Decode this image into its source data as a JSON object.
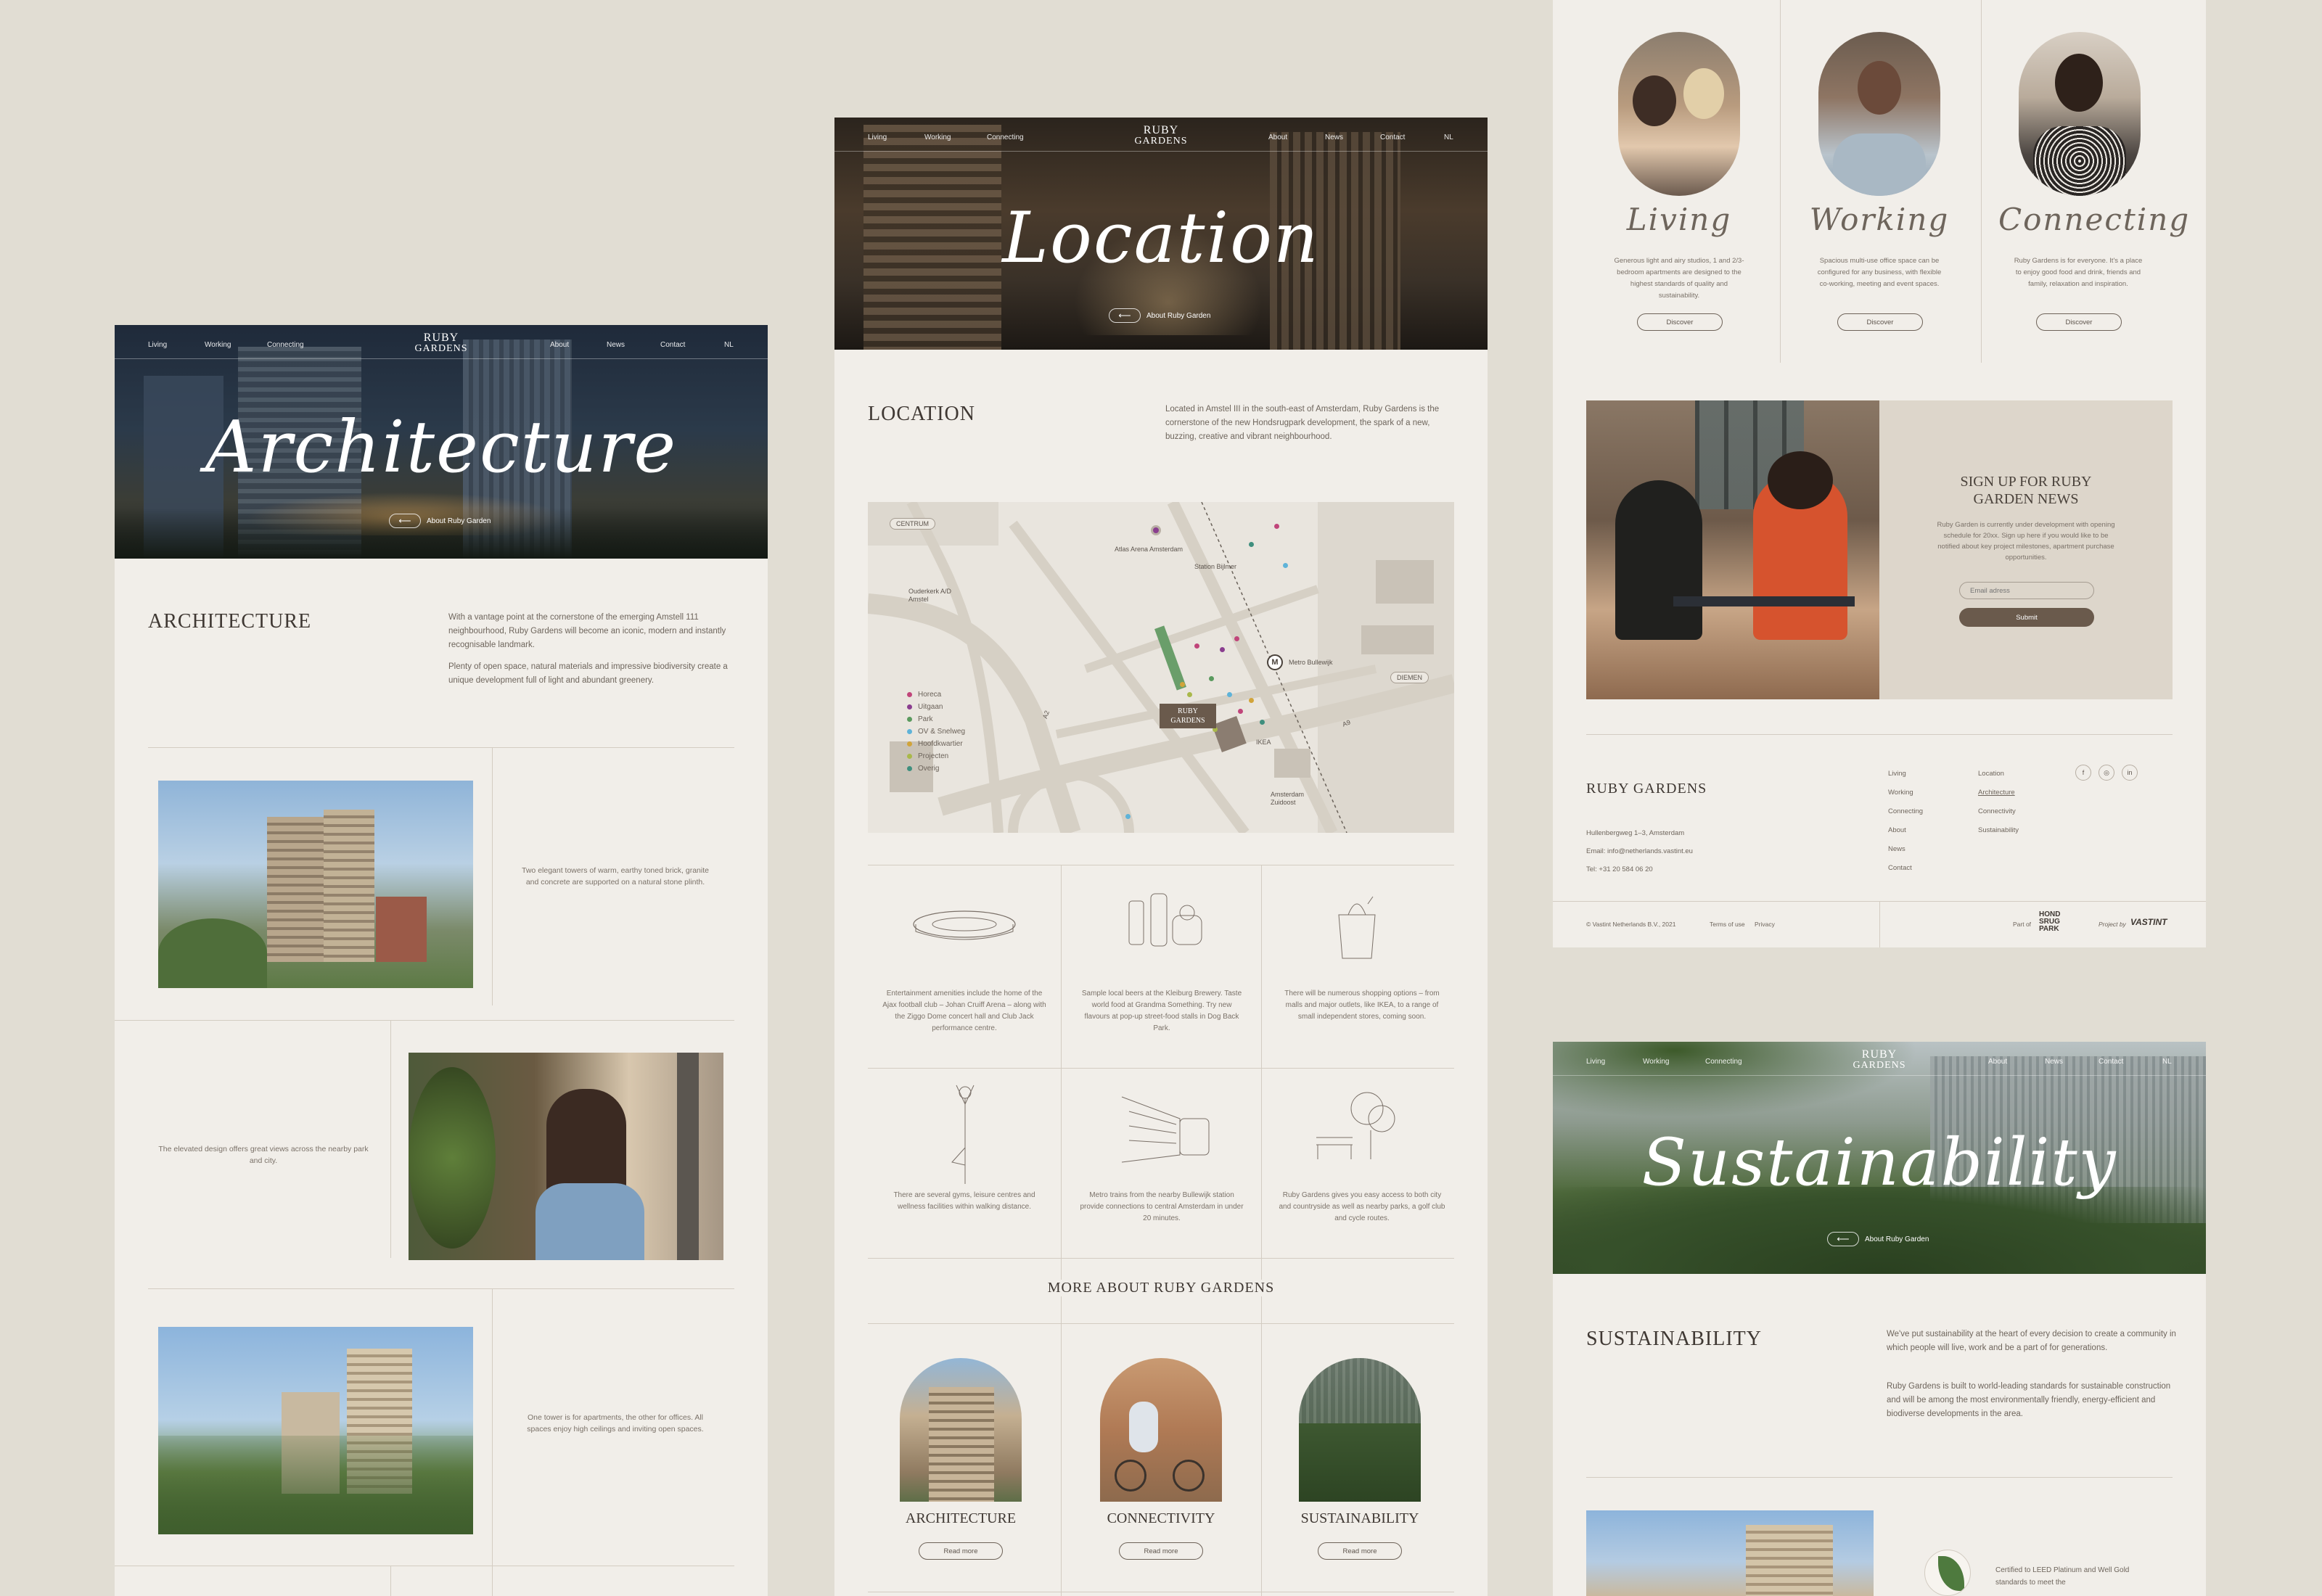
{
  "arch": {
    "nav": {
      "items": [
        "Living",
        "Working",
        "Connecting",
        "About",
        "News",
        "Contact",
        "NL"
      ],
      "logo_top": "RUBY",
      "logo_bottom": "GARDENS"
    },
    "hero_title": "Architecture",
    "back_label": "About Ruby Garden",
    "heading": "ARCHITECTURE",
    "intro1": "With a vantage point at the cornerstone of the emerging Amstell 111 neighbourhood, Ruby Gardens will become an iconic, modern and instantly recognisable landmark.",
    "intro2": "Plenty of open space, natural materials and impressive biodiversity create a unique development full of light and abundant greenery.",
    "caption1": "Two elegant towers of warm, earthy toned brick, granite and concrete are supported on a natural stone plinth.",
    "caption2": "The elevated design offers great views across the nearby park and city.",
    "caption3": "One tower is for apartments, the other for offices. All spaces enjoy high ceilings and inviting open spaces."
  },
  "loc": {
    "nav": {
      "items": [
        "Living",
        "Working",
        "Connecting",
        "About",
        "News",
        "Contact",
        "NL"
      ],
      "logo_top": "RUBY",
      "logo_bottom": "GARDENS"
    },
    "hero_title": "Location",
    "back_label": "About Ruby Garden",
    "heading": "LOCATION",
    "intro": "Located in Amstel III in the south-east of Amsterdam, Ruby Gardens is the cornerstone of the new Hondsrugpark development, the spark of a new, buzzing, creative and vibrant neighbourhood.",
    "map": {
      "centrum": "CENTRUM",
      "diemen": "DIEMEN",
      "ouderkerk": "Ouderkerk A/D Amstel",
      "arena": "Atlas Arena Amsterdam",
      "station": "Station Bijlmer",
      "metro": "Metro Bullewijk",
      "ikea": "IKEA",
      "zuidoost": "Amsterdam Zuidoost",
      "ruby_top": "RUBY",
      "ruby_bottom": "GARDENS",
      "a2": "A2",
      "a9": "A9",
      "metro_letter": "M",
      "legend": [
        {
          "label": "Horeca",
          "color": "#c0457a"
        },
        {
          "label": "Uitgaan",
          "color": "#8a3e8f"
        },
        {
          "label": "Park",
          "color": "#5a9a5e"
        },
        {
          "label": "OV & Snelweg",
          "color": "#5fb3d8"
        },
        {
          "label": "Hoofdkwartier",
          "color": "#d1a43a"
        },
        {
          "label": "Projecten",
          "color": "#a9b84a"
        },
        {
          "label": "Overig",
          "color": "#3f8f7e"
        }
      ]
    },
    "cells": [
      "Entertainment amenities include the home of the Ajax football club – Johan Cruiff Arena – along with the Ziggo Dome concert hall and Club Jack performance centre.",
      "Sample local beers at the Kleiburg Brewery. Taste world food at Grandma Something. Try new flavours at pop-up street-food stalls in Dog Back Park.",
      "There will be numerous shopping options – from malls and major outlets, like IKEA, to a range of small independent stores, coming soon.",
      "There are several gyms, leisure centres and wellness facilities within walking distance.",
      "Metro trains from the nearby Bullewijk station provide connections to central Amsterdam in under 20 minutes.",
      "Ruby Gardens gives you easy access to both city and countryside as well as nearby parks, a golf club and cycle routes."
    ],
    "more_heading": "MORE ABOUT RUBY GARDENS",
    "more": [
      {
        "title": "ARCHITECTURE",
        "button": "Read more"
      },
      {
        "title": "CONNECTIVITY",
        "button": "Read more"
      },
      {
        "title": "SUSTAINABILITY",
        "button": "Read more"
      }
    ]
  },
  "home": {
    "cards": [
      {
        "title": "Living",
        "text": "Generous light and airy studios, 1 and 2/3-bedroom apartments are designed to the highest standards of quality and sustainability.",
        "button": "Discover"
      },
      {
        "title": "Working",
        "text": "Spacious multi-use office space can be configured for any business, with flexible co-working, meeting and event spaces.",
        "button": "Discover"
      },
      {
        "title": "Connecting",
        "text": "Ruby Gardens is for everyone. It's a place to enjoy good food and drink, friends and family, relaxation and inspiration.",
        "button": "Discover"
      }
    ],
    "signup": {
      "heading1": "SIGN UP FOR RUBY",
      "heading2": "GARDEN NEWS",
      "text": "Ruby Garden is currently under development with opening schedule for 20xx. Sign up here if you would like to be notified about key project milestones, apartment purchase opportunities.",
      "placeholder": "Email adress",
      "submit": "Submit"
    },
    "footer": {
      "brand": "RUBY GARDENS",
      "address": "Hullenbergweg 1–3, Amsterdam",
      "email": "Email: info@netherlands.vastint.eu",
      "tel": "Tel: +31 20 584 06 20",
      "col1": [
        "Living",
        "Working",
        "Connecting",
        "About",
        "News",
        "Contact"
      ],
      "col2": [
        "Location",
        "Architecture",
        "Connectivity",
        "Sustainability"
      ],
      "social": [
        "f",
        "◎",
        "in"
      ],
      "copyright": "© Vastint Netherlands B.V., 2021",
      "terms": "Terms of use",
      "privacy": "Privacy",
      "part_of": "Part of",
      "hondsrug": [
        "HOND",
        "SRUG",
        "PARK"
      ],
      "project_by": "Project by",
      "vastint": "VASTINT"
    }
  },
  "sus": {
    "nav": {
      "items": [
        "Living",
        "Working",
        "Connecting",
        "About",
        "News",
        "Contact",
        "NL"
      ],
      "logo_top": "RUBY",
      "logo_bottom": "GARDENS"
    },
    "hero_title": "Sustainability",
    "back_label": "About Ruby Garden",
    "heading": "SUSTAINABILITY",
    "intro1": "We've put sustainability at the heart of every decision to create a community in which people will live, work and be a part of for generations.",
    "intro2": "Ruby Gardens is built to world-leading standards for sustainable construction and will be among the most environmentally friendly, energy-efficient and biodiverse developments in the area.",
    "leed": "Certified to LEED Platinum and Well Gold standards to meet the"
  }
}
